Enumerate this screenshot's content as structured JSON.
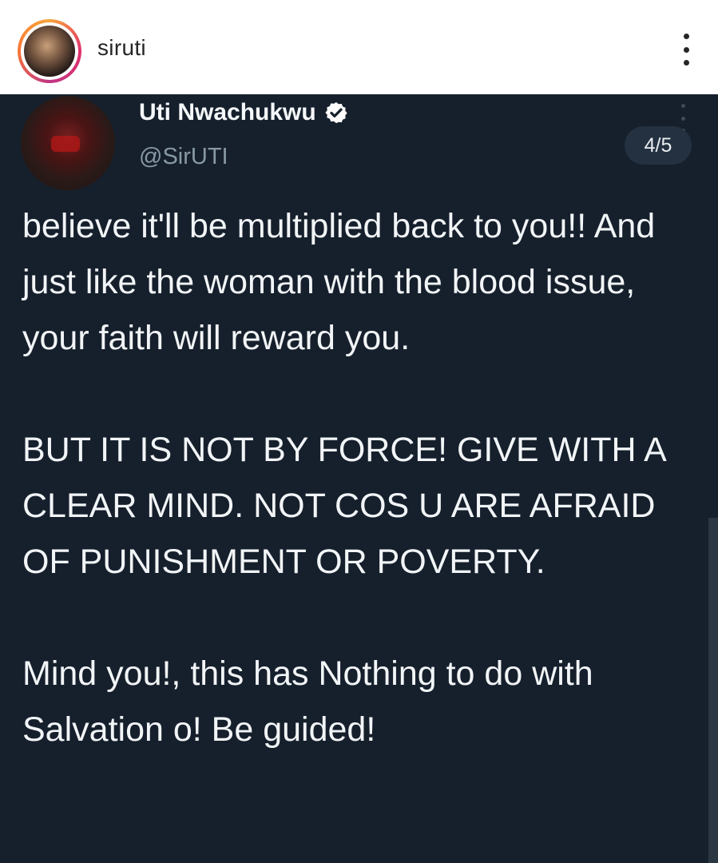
{
  "instagram": {
    "username": "siruti"
  },
  "tweet": {
    "display_name": "Uti Nwachukwu",
    "handle": "@SirUTI",
    "verified": true,
    "carousel_counter": "4/5",
    "paragraphs": [
      "believe it'll be multiplied back to you!! And just like the woman with the blood issue, your faith will reward you.",
      "BUT IT IS NOT BY FORCE! GIVE WITH A CLEAR MIND. NOT COS U ARE AFRAID OF PUNISHMENT OR POVERTY.",
      "Mind you!, this has Nothing to do with Salvation o! Be guided!"
    ]
  },
  "colors": {
    "tweet_background": "#16202c",
    "tweet_text": "#f2f5f7",
    "handle_text": "#8899a6",
    "verified_badge": "#ffffff"
  },
  "icons": {
    "verified": "verified-badge-icon",
    "more": "more-vertical-icon"
  }
}
